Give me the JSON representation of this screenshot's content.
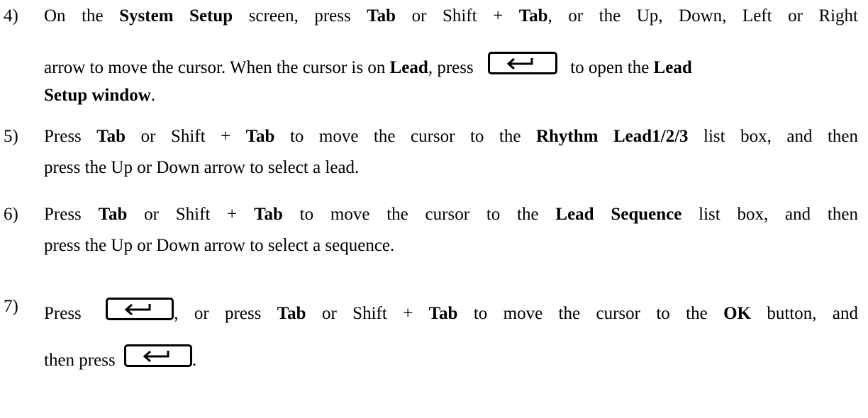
{
  "steps": [
    {
      "number": "4)",
      "line1": [
        "On the ",
        "System Setup",
        " screen, press ",
        "Tab",
        " or Shift + ",
        "Tab",
        ", or the Up, Down, Left or Right"
      ],
      "line2": [
        "arrow to move the cursor. When the cursor is on ",
        "Lead",
        ", press",
        "to open the ",
        "Lead"
      ],
      "line3": [
        "Setup window",
        "."
      ]
    },
    {
      "number": "5)",
      "line1": [
        "Press ",
        "Tab",
        " or Shift + ",
        "Tab",
        " to move the cursor to the ",
        "Rhythm Lead1/2/3",
        " list box, and then"
      ],
      "line2": "press the Up or Down arrow to select a lead."
    },
    {
      "number": "6)",
      "line1": [
        "Press ",
        "Tab",
        " or Shift + ",
        "Tab",
        " to move the cursor to the ",
        "Lead Sequence",
        " list box, and then"
      ],
      "line2": "press the Up or Down arrow to select a sequence."
    },
    {
      "number": "7)",
      "line1": [
        "Press",
        ", or press ",
        "Tab",
        " or Shift + ",
        "Tab",
        " to move the cursor to the ",
        "OK",
        " button, and"
      ],
      "line2": [
        "then press",
        "."
      ]
    }
  ],
  "icons": {
    "enter_key": "enter-key-icon"
  }
}
